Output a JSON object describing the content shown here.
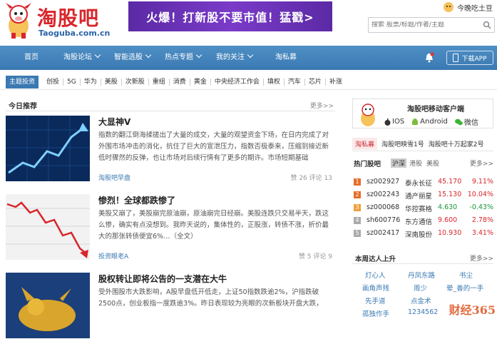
{
  "header": {
    "logo_cn": "淘股吧",
    "logo_en": "Taoguba.com.cn",
    "banner": "火爆！打新股不要市值！猛戳>",
    "username": "今晚吃土豆",
    "search_placeholder": "搜索 股票/标题/作者/主题"
  },
  "nav": {
    "items": [
      {
        "label": "首页",
        "caret": false
      },
      {
        "label": "淘股论坛",
        "caret": true
      },
      {
        "label": "智能选股",
        "caret": true
      },
      {
        "label": "热点专题",
        "caret": true
      },
      {
        "label": "我的关注",
        "caret": true
      },
      {
        "label": "淘私募",
        "caret": false
      }
    ],
    "download": "下载APP"
  },
  "tags": {
    "lead": "主题投资",
    "items": [
      "创投",
      "5G",
      "华为",
      "美股",
      "次新股",
      "重组",
      "消费",
      "黄金",
      "中央经济工作会",
      "填权",
      "汽车",
      "芯片",
      "补涨"
    ]
  },
  "main": {
    "section_title": "今日推荐",
    "more": "更多>>",
    "articles": [
      {
        "title": "大显神V",
        "body": "指数的翻江倒海揉搓出了大量的成交，大量的观望资金下场，在日内完成了对外围市场冲击的消化，抗住了巨大的宣泄压力，指数否极泰来，压缩到接近新低时骤然的反弹，也让市场对后续行情有了更多的期许。市场短期基础",
        "author": "淘股吧早盘",
        "likes": "赞 26",
        "comments": "评论 13"
      },
      {
        "title": "惨烈！全球都跌惨了",
        "body": "美股又崩了，美股崩完原油崩，原油崩完日经崩。美股连跌只交易半天，跌这么惨，确实有点没想到。我昨天说的，集体性的，正股涨，转债不涨，折价最大的那张转债便宜6%…（全文）",
        "author": "投资眼老A",
        "likes": "赞 5",
        "comments": "评论 9"
      },
      {
        "title": "股权转让即将公告的一支潜在大牛",
        "body": "受外围股市大跌影响，A股早盘低开低走，上证50指数跌逾2%，沪指跌破2500点，创业板指一度跌逾3%。昨日表现较为亮眼的次新板块开盘大跌，",
        "author": "",
        "likes": "",
        "comments": ""
      }
    ]
  },
  "side": {
    "app_title": "淘股吧移动客户端",
    "platforms": [
      "IOS",
      "Android",
      "微信"
    ],
    "tabs": [
      "淘私募",
      "淘股吧映雪1号",
      "淘股吧十万起家2号"
    ],
    "stocks_title": "热门股吧",
    "stock_tabs": [
      "沪深",
      "港股",
      "美股"
    ],
    "more": "更多>>",
    "stocks": [
      {
        "rank": "1",
        "code": "sz002927",
        "name": "泰永长征",
        "price": "45.170",
        "change": "9.11%",
        "up": true
      },
      {
        "rank": "2",
        "code": "sz002243",
        "name": "通产丽星",
        "price": "15.130",
        "change": "10.04%",
        "up": true
      },
      {
        "rank": "3",
        "code": "sz000068",
        "name": "华控赛格",
        "price": "4.630",
        "change": "-0.43%",
        "up": false
      },
      {
        "rank": "4",
        "code": "sh600776",
        "name": "东方通信",
        "price": "9.600",
        "change": "2.78%",
        "up": true
      },
      {
        "rank": "5",
        "code": "sz002417",
        "name": "深南股份",
        "price": "10.930",
        "change": "3.41%",
        "up": true
      }
    ],
    "week_title": "本周达人上升",
    "week_people": [
      "灯心人",
      "丹凤东路",
      "书尘",
      "画角声残",
      "周少",
      "晕_善的一手",
      "先手道",
      "点金术",
      "",
      "孤独作手",
      "1234562",
      ""
    ]
  },
  "watermark": "财经365",
  "colors": {
    "brand_red": "#d8262b",
    "nav_blue": "#3b79b2",
    "banner_purple": "#6a32b8",
    "up": "#d8262b",
    "down": "#1a9a3a"
  }
}
